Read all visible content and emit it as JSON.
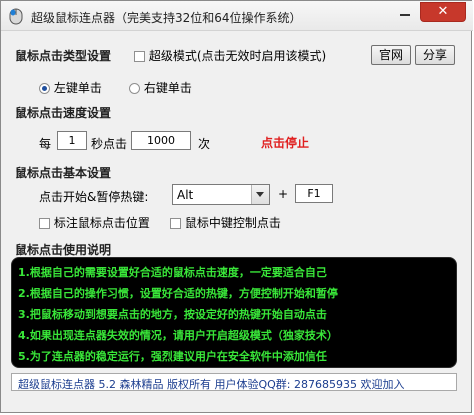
{
  "window": {
    "title": "超级鼠标连点器（完美支持32位和64位操作系统）",
    "close_glyph": "✕"
  },
  "click_type": {
    "header": "鼠标点击类型设置",
    "super_mode_label": "超级模式(点击无效时启用该模式)",
    "official_button": "官网",
    "share_button": "分享",
    "left_click_label": "左键单击",
    "right_click_label": "右键单击",
    "selected": "left"
  },
  "speed": {
    "header": "鼠标点击速度设置",
    "prefix": "每",
    "seconds_value": "1",
    "middle": "秒点击",
    "count_value": "1000",
    "suffix": "次",
    "status_text": "点击停止",
    "status_color": "#e02020"
  },
  "basic": {
    "header": "鼠标点击基本设置",
    "hotkey_label": "点击开始&暂停热键:",
    "modifier_value": "Alt",
    "plus": "+",
    "key_value": "F1",
    "mark_position_label": "标注鼠标点击位置",
    "middle_click_label": "鼠标中键控制点击"
  },
  "usage": {
    "header": "鼠标点击使用说明",
    "lines": [
      "1.根据自己的需要设置好合适的鼠标点击速度，一定要适合自己",
      "2.根据自己的操作习惯，设置好合适的热键，方便控制开始和暂停",
      "3.把鼠标移动到想要点击的地方，按设定好的热键开始自动点击",
      "4.如果出现连点器失效的情况，请用户开启超级模式（独家技术）",
      "5.为了连点器的稳定运行，强烈建议用户在安全软件中添加信任"
    ],
    "text_color": "#39e639"
  },
  "statusbar": {
    "text": "超级鼠标连点器 5.2 森林精品 版权所有 用户体验QQ群: 287685935 欢迎加入"
  }
}
